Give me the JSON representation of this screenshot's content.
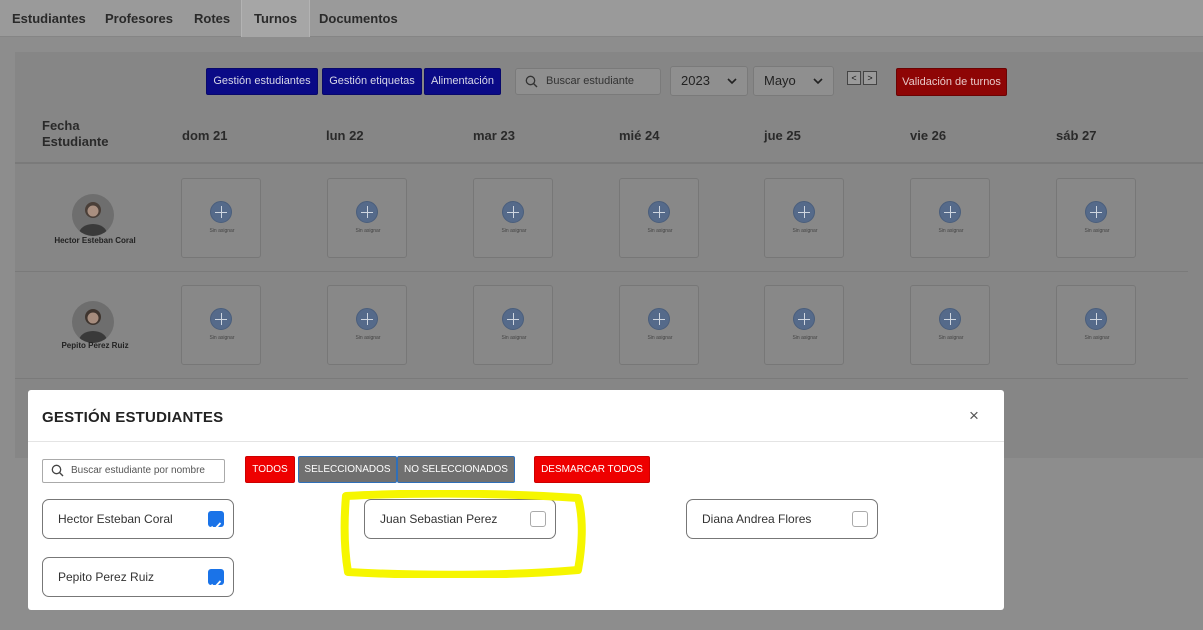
{
  "tabs": [
    {
      "label": "Estudiantes"
    },
    {
      "label": "Profesores"
    },
    {
      "label": "Rotes"
    },
    {
      "label": "Turnos"
    },
    {
      "label": "Documentos"
    }
  ],
  "toolbar": {
    "btn_gestion_estudiantes": "Gestión estudiantes",
    "btn_gestion_etiquetas": "Gestión etiquetas",
    "btn_alimentacion": "Alimentación",
    "search_placeholder": "Buscar estudiante",
    "year": "2023",
    "month": "Mayo",
    "prev": "<",
    "next": ">",
    "btn_validacion": "Validación de turnos"
  },
  "grid": {
    "header_fecha": "Fecha",
    "header_estudiante": "Estudiante",
    "days": [
      "dom 21",
      "lun 22",
      "mar 23",
      "mié 24",
      "jue 25",
      "vie 26",
      "sáb 27"
    ],
    "slot_label": "Sin asignar",
    "students": [
      "Hector Esteban Coral",
      "Pepito Perez Ruiz"
    ]
  },
  "modal": {
    "title": "GESTIÓN ESTUDIANTES",
    "close": "×",
    "search_placeholder": "Buscar estudiante por nombre",
    "filters": {
      "todos": "TODOS",
      "seleccionados": "SELECCIONADOS",
      "no_seleccionados": "NO SELECCIONADOS",
      "desmarcar": "DESMARCAR TODOS"
    },
    "students": [
      {
        "name": "Hector Esteban Coral",
        "checked": true
      },
      {
        "name": "Juan Sebastian Perez",
        "checked": false
      },
      {
        "name": "Diana Andrea Flores",
        "checked": false
      },
      {
        "name": "Pepito Perez Ruiz",
        "checked": true
      }
    ]
  },
  "colors": {
    "primary_blue": "#1a73e8",
    "filter_red": "#ee0000",
    "highlight": "#f6f600"
  }
}
